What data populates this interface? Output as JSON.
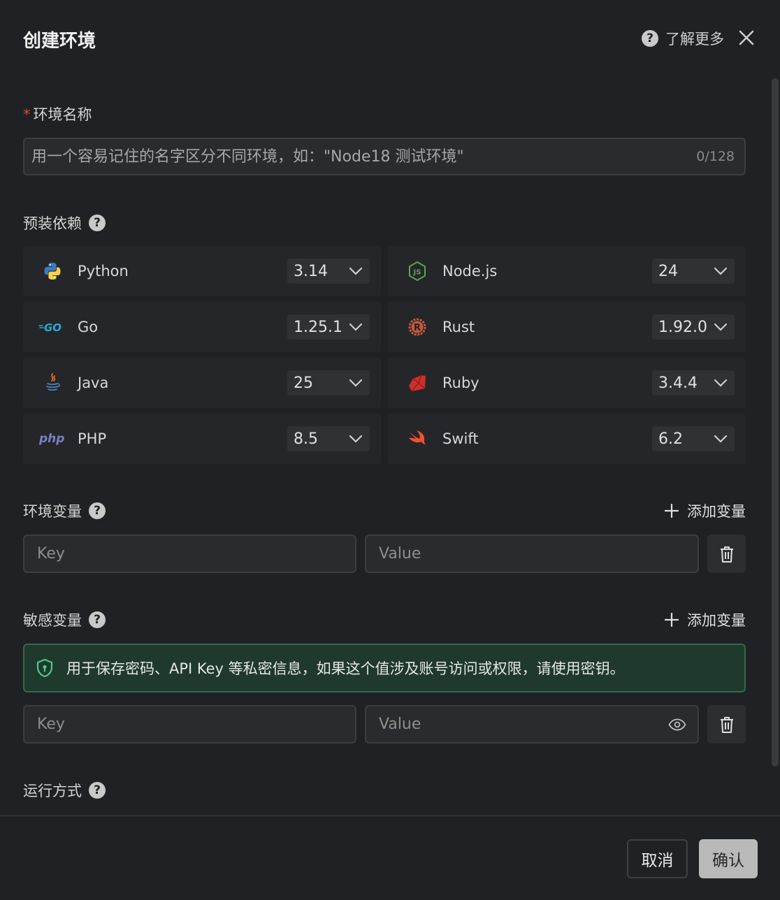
{
  "dialog": {
    "title": "创建环境",
    "learn_more": "了解更多"
  },
  "env_name": {
    "label": "环境名称",
    "placeholder": "用一个容易记住的名字区分不同环境，如：\"Node18 测试环境\"",
    "counter": "0/128"
  },
  "deps": {
    "label": "预装依赖",
    "items": [
      {
        "name": "Python",
        "version": "3.14",
        "icon": "python-icon"
      },
      {
        "name": "Node.js",
        "version": "24",
        "icon": "nodejs-icon"
      },
      {
        "name": "Go",
        "version": "1.25.1",
        "icon": "go-icon"
      },
      {
        "name": "Rust",
        "version": "1.92.0",
        "icon": "rust-icon"
      },
      {
        "name": "Java",
        "version": "25",
        "icon": "java-icon"
      },
      {
        "name": "Ruby",
        "version": "3.4.4",
        "icon": "ruby-icon"
      },
      {
        "name": "PHP",
        "version": "8.5",
        "icon": "php-icon"
      },
      {
        "name": "Swift",
        "version": "6.2",
        "icon": "swift-icon"
      }
    ]
  },
  "env_vars": {
    "label": "环境变量",
    "add_label": "添加变量",
    "key_placeholder": "Key",
    "value_placeholder": "Value"
  },
  "secret_vars": {
    "label": "敏感变量",
    "add_label": "添加变量",
    "notice": "用于保存密码、API Key 等私密信息，如果这个值涉及账号访问或权限，请使用密钥。",
    "key_placeholder": "Key",
    "value_placeholder": "Value"
  },
  "run_mode": {
    "label": "运行方式"
  },
  "footer": {
    "cancel_label": "取消",
    "confirm_label": "确认"
  },
  "colors": {
    "background": "#202124",
    "required": "#e0443e",
    "notice_bg": "#1f3a2d",
    "notice_border": "#2f6a4c",
    "confirm_bg": "#b9b9b9"
  }
}
